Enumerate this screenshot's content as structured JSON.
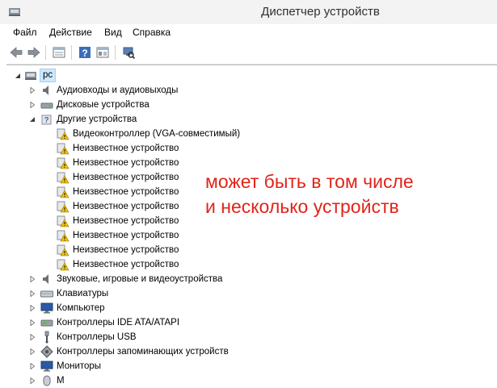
{
  "window": {
    "title": "Диспетчер устройств"
  },
  "menu": {
    "file": "Файл",
    "action": "Действие",
    "view": "Вид",
    "help": "Справка"
  },
  "tree": {
    "root": "pc",
    "categories": {
      "audio_io": "Аудиовходы и аудиовыходы",
      "disk": "Дисковые устройства",
      "other": "Другие устройства",
      "sound": "Звуковые, игровые и видеоустройства",
      "keyboards": "Клавиатуры",
      "computer": "Компьютер",
      "ide": "Контроллеры IDE ATA/ATAPI",
      "usb": "Контроллеры USB",
      "storage": "Контроллеры запоминающих устройств",
      "monitors": "Мониторы",
      "partial_last": "М"
    },
    "other_devices": [
      "Видеоконтроллер (VGA-совместимый)",
      "Неизвестное устройство",
      "Неизвестное устройство",
      "Неизвестное устройство",
      "Неизвестное устройство",
      "Неизвестное устройство",
      "Неизвестное устройство",
      "Неизвестное устройство",
      "Неизвестное устройство",
      "Неизвестное устройство"
    ]
  },
  "annotation": {
    "line1": "может быть в том числе",
    "line2": "и несколько устройств"
  },
  "colors": {
    "annotation": "#e2231a",
    "selection": "#cce8ff",
    "warning": "#f5c400"
  }
}
